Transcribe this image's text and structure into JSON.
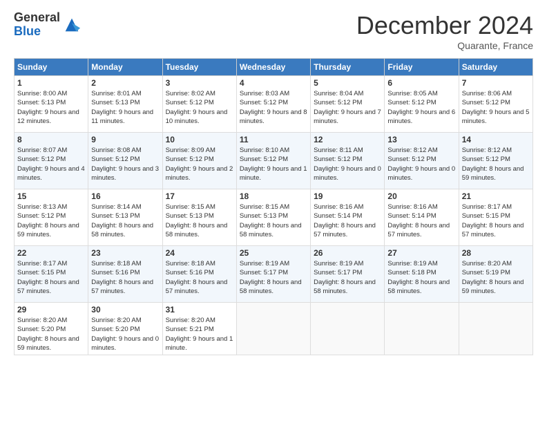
{
  "header": {
    "logo_line1": "General",
    "logo_line2": "Blue",
    "month_title": "December 2024",
    "location": "Quarante, France"
  },
  "weekdays": [
    "Sunday",
    "Monday",
    "Tuesday",
    "Wednesday",
    "Thursday",
    "Friday",
    "Saturday"
  ],
  "weeks": [
    [
      {
        "day": "1",
        "sunrise": "Sunrise: 8:00 AM",
        "sunset": "Sunset: 5:13 PM",
        "daylight": "Daylight: 9 hours and 12 minutes."
      },
      {
        "day": "2",
        "sunrise": "Sunrise: 8:01 AM",
        "sunset": "Sunset: 5:13 PM",
        "daylight": "Daylight: 9 hours and 11 minutes."
      },
      {
        "day": "3",
        "sunrise": "Sunrise: 8:02 AM",
        "sunset": "Sunset: 5:12 PM",
        "daylight": "Daylight: 9 hours and 10 minutes."
      },
      {
        "day": "4",
        "sunrise": "Sunrise: 8:03 AM",
        "sunset": "Sunset: 5:12 PM",
        "daylight": "Daylight: 9 hours and 8 minutes."
      },
      {
        "day": "5",
        "sunrise": "Sunrise: 8:04 AM",
        "sunset": "Sunset: 5:12 PM",
        "daylight": "Daylight: 9 hours and 7 minutes."
      },
      {
        "day": "6",
        "sunrise": "Sunrise: 8:05 AM",
        "sunset": "Sunset: 5:12 PM",
        "daylight": "Daylight: 9 hours and 6 minutes."
      },
      {
        "day": "7",
        "sunrise": "Sunrise: 8:06 AM",
        "sunset": "Sunset: 5:12 PM",
        "daylight": "Daylight: 9 hours and 5 minutes."
      }
    ],
    [
      {
        "day": "8",
        "sunrise": "Sunrise: 8:07 AM",
        "sunset": "Sunset: 5:12 PM",
        "daylight": "Daylight: 9 hours and 4 minutes."
      },
      {
        "day": "9",
        "sunrise": "Sunrise: 8:08 AM",
        "sunset": "Sunset: 5:12 PM",
        "daylight": "Daylight: 9 hours and 3 minutes."
      },
      {
        "day": "10",
        "sunrise": "Sunrise: 8:09 AM",
        "sunset": "Sunset: 5:12 PM",
        "daylight": "Daylight: 9 hours and 2 minutes."
      },
      {
        "day": "11",
        "sunrise": "Sunrise: 8:10 AM",
        "sunset": "Sunset: 5:12 PM",
        "daylight": "Daylight: 9 hours and 1 minute."
      },
      {
        "day": "12",
        "sunrise": "Sunrise: 8:11 AM",
        "sunset": "Sunset: 5:12 PM",
        "daylight": "Daylight: 9 hours and 0 minutes."
      },
      {
        "day": "13",
        "sunrise": "Sunrise: 8:12 AM",
        "sunset": "Sunset: 5:12 PM",
        "daylight": "Daylight: 9 hours and 0 minutes."
      },
      {
        "day": "14",
        "sunrise": "Sunrise: 8:12 AM",
        "sunset": "Sunset: 5:12 PM",
        "daylight": "Daylight: 8 hours and 59 minutes."
      }
    ],
    [
      {
        "day": "15",
        "sunrise": "Sunrise: 8:13 AM",
        "sunset": "Sunset: 5:12 PM",
        "daylight": "Daylight: 8 hours and 59 minutes."
      },
      {
        "day": "16",
        "sunrise": "Sunrise: 8:14 AM",
        "sunset": "Sunset: 5:13 PM",
        "daylight": "Daylight: 8 hours and 58 minutes."
      },
      {
        "day": "17",
        "sunrise": "Sunrise: 8:15 AM",
        "sunset": "Sunset: 5:13 PM",
        "daylight": "Daylight: 8 hours and 58 minutes."
      },
      {
        "day": "18",
        "sunrise": "Sunrise: 8:15 AM",
        "sunset": "Sunset: 5:13 PM",
        "daylight": "Daylight: 8 hours and 58 minutes."
      },
      {
        "day": "19",
        "sunrise": "Sunrise: 8:16 AM",
        "sunset": "Sunset: 5:14 PM",
        "daylight": "Daylight: 8 hours and 57 minutes."
      },
      {
        "day": "20",
        "sunrise": "Sunrise: 8:16 AM",
        "sunset": "Sunset: 5:14 PM",
        "daylight": "Daylight: 8 hours and 57 minutes."
      },
      {
        "day": "21",
        "sunrise": "Sunrise: 8:17 AM",
        "sunset": "Sunset: 5:15 PM",
        "daylight": "Daylight: 8 hours and 57 minutes."
      }
    ],
    [
      {
        "day": "22",
        "sunrise": "Sunrise: 8:17 AM",
        "sunset": "Sunset: 5:15 PM",
        "daylight": "Daylight: 8 hours and 57 minutes."
      },
      {
        "day": "23",
        "sunrise": "Sunrise: 8:18 AM",
        "sunset": "Sunset: 5:16 PM",
        "daylight": "Daylight: 8 hours and 57 minutes."
      },
      {
        "day": "24",
        "sunrise": "Sunrise: 8:18 AM",
        "sunset": "Sunset: 5:16 PM",
        "daylight": "Daylight: 8 hours and 57 minutes."
      },
      {
        "day": "25",
        "sunrise": "Sunrise: 8:19 AM",
        "sunset": "Sunset: 5:17 PM",
        "daylight": "Daylight: 8 hours and 58 minutes."
      },
      {
        "day": "26",
        "sunrise": "Sunrise: 8:19 AM",
        "sunset": "Sunset: 5:17 PM",
        "daylight": "Daylight: 8 hours and 58 minutes."
      },
      {
        "day": "27",
        "sunrise": "Sunrise: 8:19 AM",
        "sunset": "Sunset: 5:18 PM",
        "daylight": "Daylight: 8 hours and 58 minutes."
      },
      {
        "day": "28",
        "sunrise": "Sunrise: 8:20 AM",
        "sunset": "Sunset: 5:19 PM",
        "daylight": "Daylight: 8 hours and 59 minutes."
      }
    ],
    [
      {
        "day": "29",
        "sunrise": "Sunrise: 8:20 AM",
        "sunset": "Sunset: 5:20 PM",
        "daylight": "Daylight: 8 hours and 59 minutes."
      },
      {
        "day": "30",
        "sunrise": "Sunrise: 8:20 AM",
        "sunset": "Sunset: 5:20 PM",
        "daylight": "Daylight: 9 hours and 0 minutes."
      },
      {
        "day": "31",
        "sunrise": "Sunrise: 8:20 AM",
        "sunset": "Sunset: 5:21 PM",
        "daylight": "Daylight: 9 hours and 1 minute."
      },
      null,
      null,
      null,
      null
    ]
  ]
}
